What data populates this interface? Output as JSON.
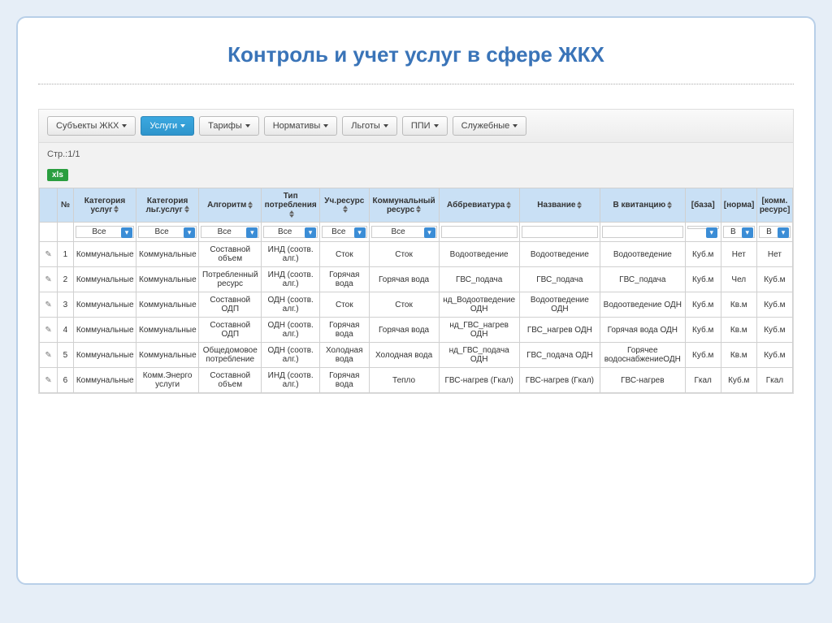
{
  "title": "Контроль и учет услуг в сфере ЖКХ",
  "toolbar": {
    "items": [
      {
        "label": "Субъекты ЖКХ",
        "active": false
      },
      {
        "label": "Услуги",
        "active": true
      },
      {
        "label": "Тарифы",
        "active": false
      },
      {
        "label": "Нормативы",
        "active": false
      },
      {
        "label": "Льготы",
        "active": false
      },
      {
        "label": "ППИ",
        "active": false
      },
      {
        "label": "Служебные",
        "active": false
      }
    ]
  },
  "meta": {
    "page": "Стр.:1/1",
    "xls": "xls"
  },
  "headers": {
    "num": "№",
    "cat_service": "Категория услуг",
    "cat_benefit": "Категория льг.услуг",
    "algorithm": "Алгоритм",
    "consumption_type": "Тип потребления",
    "acc_resource": "Уч.ресурс",
    "comm_resource": "Коммунальный ресурс",
    "abbreviation": "Аббревиатура",
    "name": "Название",
    "in_receipt": "В квитанцию",
    "base": "[база]",
    "norm": "[норма]",
    "komm_res": "[комм. ресурс]"
  },
  "filters": {
    "all": "Все",
    "b": "В"
  },
  "rows": [
    {
      "n": "1",
      "cat": "Коммунальные",
      "ben": "Коммунальные",
      "alg": "Составной объем",
      "type": "ИНД (соотв. алг.)",
      "res": "Сток",
      "kres": "Сток",
      "abbr": "Водоотведение",
      "name": "Водоотведение",
      "rec": "Водоотведение",
      "base": "Куб.м",
      "norm": "Нет",
      "kr": "Нет"
    },
    {
      "n": "2",
      "cat": "Коммунальные",
      "ben": "Коммунальные",
      "alg": "Потребленный ресурс",
      "type": "ИНД (соотв. алг.)",
      "res": "Горячая вода",
      "kres": "Горячая вода",
      "abbr": "ГВС_подача",
      "name": "ГВС_подача",
      "rec": "ГВС_подача",
      "base": "Куб.м",
      "norm": "Чел",
      "kr": "Куб.м"
    },
    {
      "n": "3",
      "cat": "Коммунальные",
      "ben": "Коммунальные",
      "alg": "Составной ОДП",
      "type": "ОДН (соотв. алг.)",
      "res": "Сток",
      "kres": "Сток",
      "abbr": "нд_Водоотведение ОДН",
      "name": "Водоотведение ОДН",
      "rec": "Водоотведение ОДН",
      "base": "Куб.м",
      "norm": "Кв.м",
      "kr": "Куб.м"
    },
    {
      "n": "4",
      "cat": "Коммунальные",
      "ben": "Коммунальные",
      "alg": "Составной ОДП",
      "type": "ОДН (соотв. алг.)",
      "res": "Горячая вода",
      "kres": "Горячая вода",
      "abbr": "нд_ГВС_нагрев ОДН",
      "name": "ГВС_нагрев ОДН",
      "rec": "Горячая вода ОДН",
      "base": "Куб.м",
      "norm": "Кв.м",
      "kr": "Куб.м"
    },
    {
      "n": "5",
      "cat": "Коммунальные",
      "ben": "Коммунальные",
      "alg": "Общедомовое потребление",
      "type": "ОДН (соотв. алг.)",
      "res": "Холодная вода",
      "kres": "Холодная вода",
      "abbr": "нд_ГВС_подача ОДН",
      "name": "ГВС_подача ОДН",
      "rec": "Горячее водоснабжениеОДН",
      "base": "Куб.м",
      "norm": "Кв.м",
      "kr": "Куб.м"
    },
    {
      "n": "6",
      "cat": "Коммунальные",
      "ben": "Комм.Энерго услуги",
      "alg": "Составной объем",
      "type": "ИНД (соотв. алг.)",
      "res": "Горячая вода",
      "kres": "Тепло",
      "abbr": "ГВС-нагрев (Гкал)",
      "name": "ГВС-нагрев (Гкал)",
      "rec": "ГВС-нагрев",
      "base": "Гкал",
      "norm": "Куб.м",
      "kr": "Гкал"
    }
  ]
}
